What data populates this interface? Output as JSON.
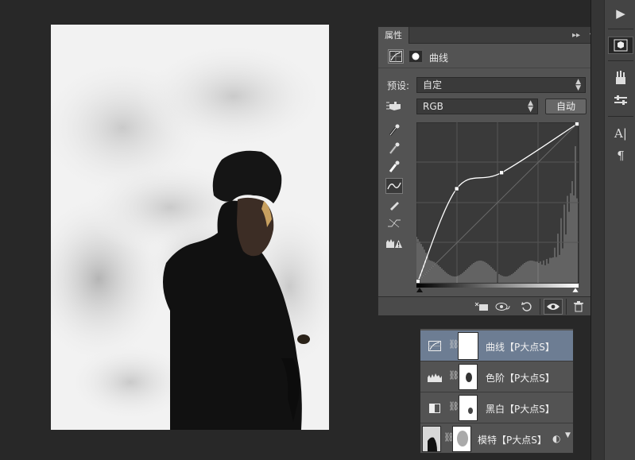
{
  "properties_panel": {
    "tab_label": "属性",
    "title": "曲线",
    "preset_label": "预设:",
    "preset_value": "自定",
    "channel_value": "RGB",
    "auto_button": "自动",
    "icons": {
      "adjustment": "curves-adjustment-icon",
      "mask": "layer-mask-icon",
      "on_image": "on-image-adjust-hand-icon",
      "tools": [
        "eyedropper-black-icon",
        "eyedropper-gray-icon",
        "eyedropper-white-icon",
        "curve-point-icon",
        "pencil-icon",
        "smooth-curve-icon",
        "clipping-warning-icon"
      ],
      "footer": [
        "clip-to-layer-icon",
        "view-previous-state-icon",
        "reset-icon",
        "visibility-eye-icon",
        "delete-icon"
      ]
    },
    "curve_points": [
      [
        0,
        0
      ],
      [
        62,
        150
      ],
      [
        134,
        176
      ],
      [
        255,
        255
      ]
    ],
    "curve_colors": {
      "curve": "#ffffff",
      "graph_bg": "#3a3a3a",
      "histogram": "#8c8c8c"
    }
  },
  "layers": [
    {
      "name": "曲线【P大点S】",
      "icon": "curves-adjustment-icon",
      "selected": true
    },
    {
      "name": "色阶【P大点S】",
      "icon": "levels-adjustment-icon",
      "selected": false
    },
    {
      "name": "黑白【P大点S】",
      "icon": "black-white-adjustment-icon",
      "selected": false
    },
    {
      "name": "模特【P大点S】",
      "icon": "smart-object-icon",
      "selected": false
    }
  ],
  "right_dock": {
    "icons": [
      "play-icon",
      "properties-cube-icon",
      "brush-presets-icon",
      "adjustments-sliders-icon",
      "character-text-icon",
      "paragraph-icon"
    ]
  },
  "colors": {
    "workspace": "#282828",
    "panel": "#535353",
    "selected_layer": "#6d7d93"
  }
}
